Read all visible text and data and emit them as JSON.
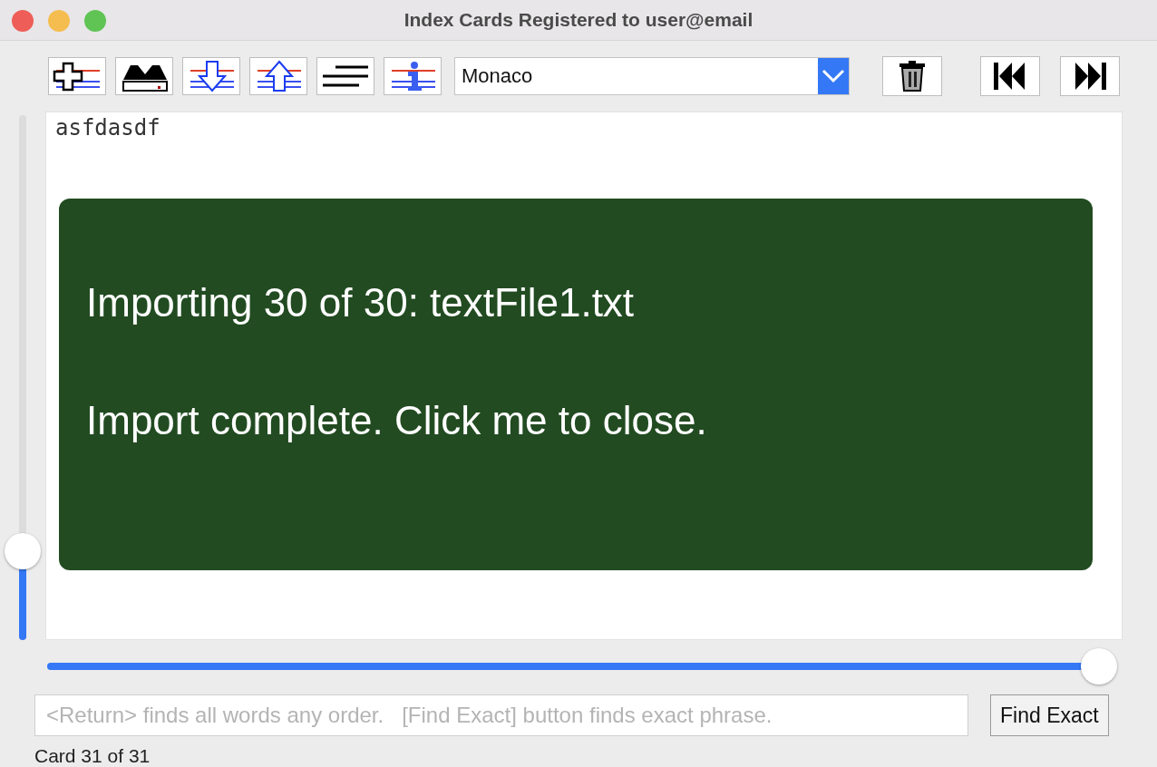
{
  "window": {
    "title": "Index Cards Registered to user@email"
  },
  "toolbar": {
    "font_select": {
      "value": "Monaco"
    }
  },
  "card": {
    "text": "asfdasdf",
    "scroll": {
      "level": 0.17
    }
  },
  "notice": {
    "lines": [
      "Importing 30 of 30: textFile1.txt",
      "Import complete. Click me to close."
    ]
  },
  "card_slider": {
    "level": 1.0
  },
  "search": {
    "placeholder": "<Return> finds all words any order.   [Find Exact] button finds exact phrase.",
    "button": "Find Exact"
  },
  "status_bar": {
    "text": "Card 31 of 31"
  }
}
